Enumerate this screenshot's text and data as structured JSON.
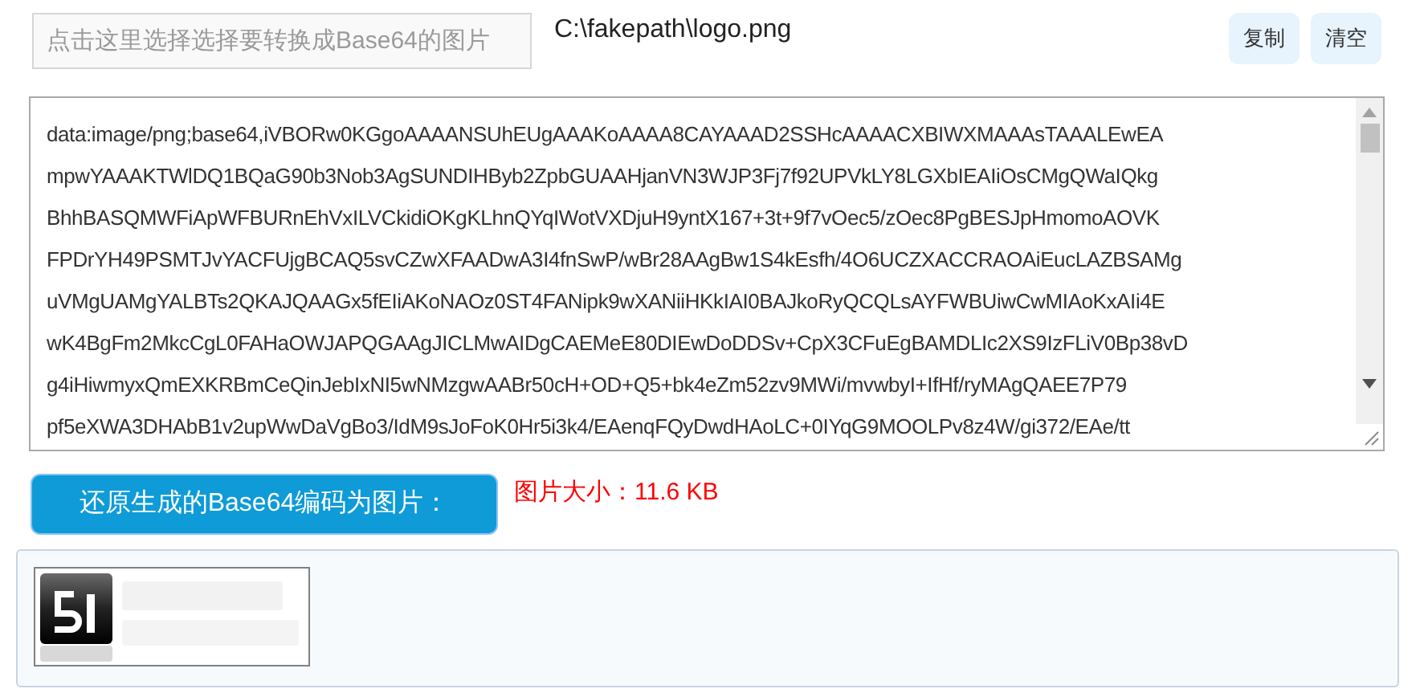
{
  "file_picker": {
    "placeholder": "点击这里选择选择要转换成Base64的图片"
  },
  "file_path": "C:\\fakepath\\logo.png",
  "buttons": [
    "复制",
    "清空"
  ],
  "base64_output": {
    "lines": [
      "data:image/png;base64,iVBORw0KGgoAAAANSUhEUgAAAKoAAAA8CAYAAAD2SSHcAAAACXBIWXMAAAsTAAALEwEA",
      "mpwYAAAKTWlDQ1BQaG90b3Nob3AgSUNDIHByb2ZpbGUAAHjanVN3WJP3Fj7f92UPVkLY8LGXbIEAIiOsCMgQWaIQkg",
      "BhhBASQMWFiApWFBURnEhVxILVCkidiOKgKLhnQYqIWotVXDjuH9yntX167+3t+9f7vOec5/zOec8PgBESJpHmomoAOVK",
      "FPDrYH49PSMTJvYACFUjgBCAQ5svCZwXFAADwA3I4fnSwP/wBr28AAgBw1S4kEsfh/4O6UCZXACCRAOAiEucLAZBSAMg",
      "uVMgUAMgYALBTs2QKAJQAAGx5fEIiAKoNAOz0ST4FANipk9wXANiiHKkIAI0BAJkoRyQCQLsAYFWBUiwCwMIAoKxAIi4E",
      "wK4BgFm2MkcCgL0FAHaOWJAPQGAAgJICLMwAIDgCAEMeE80DIEwDoDDSv+CpX3CFuEgBAMDLIc2XS9IzFLiV0Bp38vD",
      "g4iHiwmyxQmEXKRBmCeQinJebIxNI5wNMzgwAABr50cH+OD+Q5+bk4eZm52zv9MWi/mvwbyI+IfHf/ryMAgQAEE7P79",
      "pf5eXWA3DHAbB1v2upWwDaVgBo3/IdM9sJoFoK0Hr5i3k4/EAenqFQyDwdHAoLC+0IYqG9MOOLPv8z4W/gi372/EAe/tt"
    ]
  },
  "convert_button": "还原生成的Base64编码为图片：",
  "size_label": "图片大小：11.6 KB"
}
